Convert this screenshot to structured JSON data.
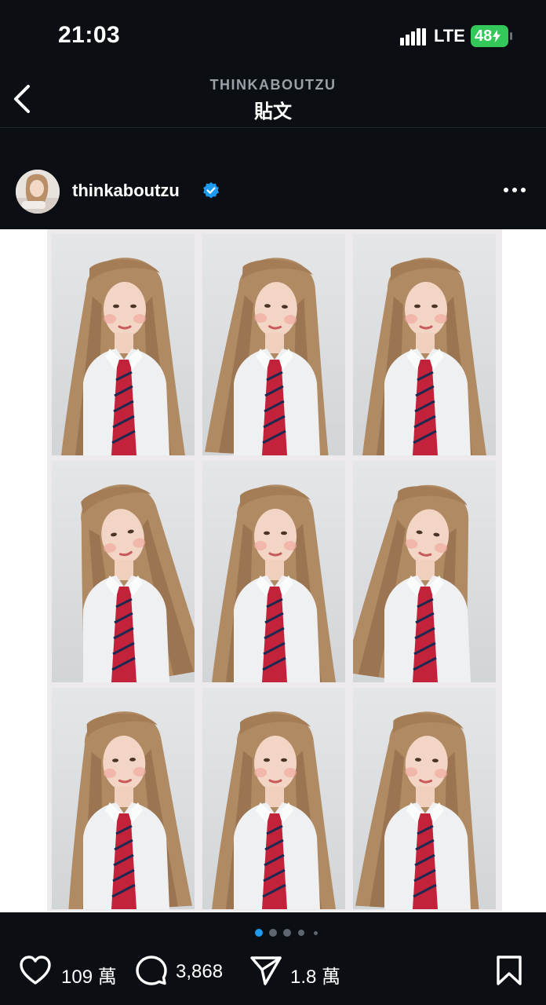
{
  "status": {
    "time": "21:03",
    "network": "LTE",
    "battery": "48"
  },
  "nav": {
    "account": "THINKABOUTZU",
    "title": "貼文"
  },
  "post": {
    "username": "thinkaboutzu",
    "verified_color": "#1da1f2",
    "photo_grid": {
      "rows": 3,
      "cols": 3
    }
  },
  "carousel": {
    "total_dots": 5,
    "active_index": 0
  },
  "actions": {
    "likes": "109 萬",
    "comments": "3,868",
    "shares": "1.8 萬"
  },
  "icons": [
    "back-chevron-icon",
    "signal-icon",
    "battery-icon",
    "verified-badge-icon",
    "more-options-icon",
    "heart-icon",
    "comment-icon",
    "share-icon",
    "bookmark-icon"
  ]
}
